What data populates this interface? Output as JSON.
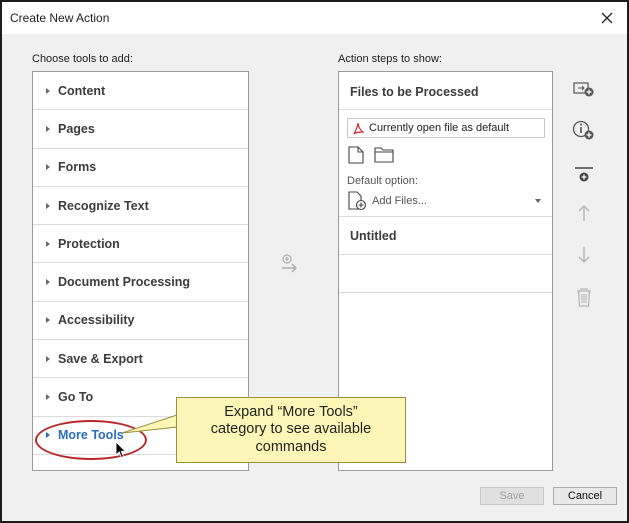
{
  "window": {
    "title": "Create New Action"
  },
  "left_panel": {
    "label": "Choose tools to add:",
    "tools": [
      "Content",
      "Pages",
      "Forms",
      "Recognize Text",
      "Protection",
      "Document Processing",
      "Accessibility",
      "Save & Export",
      "Go To",
      "More Tools"
    ],
    "active_tool": "More Tools"
  },
  "right_panel": {
    "label": "Action steps to show:",
    "files_header": "Files to be Processed",
    "file_source_value": "Currently open file as default",
    "default_option_label": "Default option:",
    "add_files_value": "Add Files...",
    "untitled_label": "Untitled"
  },
  "side_icons": [
    "add-step-icon",
    "add-instruction-icon",
    "add-divider-icon",
    "move-up-icon",
    "move-down-icon",
    "trash-icon"
  ],
  "callout": {
    "line1": "Expand “More Tools”",
    "line2": "category to see available",
    "line3": "commands"
  },
  "buttons": {
    "save": "Save",
    "cancel": "Cancel"
  },
  "colors": {
    "active_blue": "#2a6cbf",
    "callout_fill": "#fdf7b7",
    "highlight_red": "#b8282a"
  }
}
